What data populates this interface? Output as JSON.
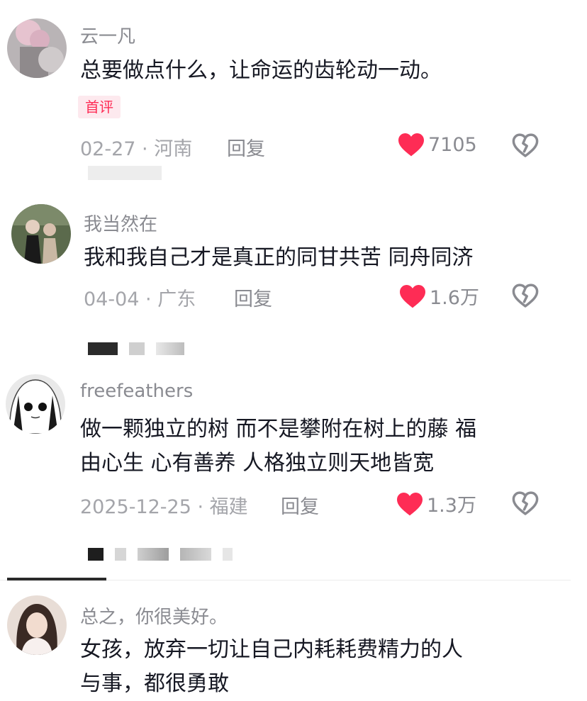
{
  "comments": [
    {
      "username": "云一凡",
      "content_lines": [
        "总要做点什么，让命运的齿轮动一动。"
      ],
      "tag": "首评",
      "date": "02-27",
      "location": "河南",
      "reply_label": "回复",
      "likes": "7105",
      "avatar_icon": "avatar-photo-flowers"
    },
    {
      "username": "我当然在",
      "content_lines": [
        "我和我自己才是真正的同甘共苦 同舟同济"
      ],
      "date": "04-04",
      "location": "广东",
      "reply_label": "回复",
      "likes": "1.6万",
      "avatar_icon": "avatar-photo-two-girls"
    },
    {
      "username": "freefeathers",
      "content_lines": [
        "做一颗独立的树 而不是攀附在树上的藤 福",
        "由心生 心有善养 人格独立则天地皆宽"
      ],
      "date": "2025-12-25",
      "location": "福建",
      "reply_label": "回复",
      "likes": "1.3万",
      "avatar_icon": "avatar-anime-girl"
    },
    {
      "username": "总之，你很美好。",
      "content_lines": [
        "女孩，放弃一切让自己内耗耗费精力的人",
        "与事，都很勇敢"
      ],
      "avatar_icon": "avatar-photo-girl"
    }
  ],
  "separator": " · ",
  "colors": {
    "like_heart": "#fe2c55",
    "username": "#8a8b91",
    "meta": "#a4a5aa",
    "text": "#161823",
    "tag_bg": "#fde9ee"
  },
  "icons": {
    "like": "heart-icon",
    "dislike": "broken-heart-icon"
  }
}
